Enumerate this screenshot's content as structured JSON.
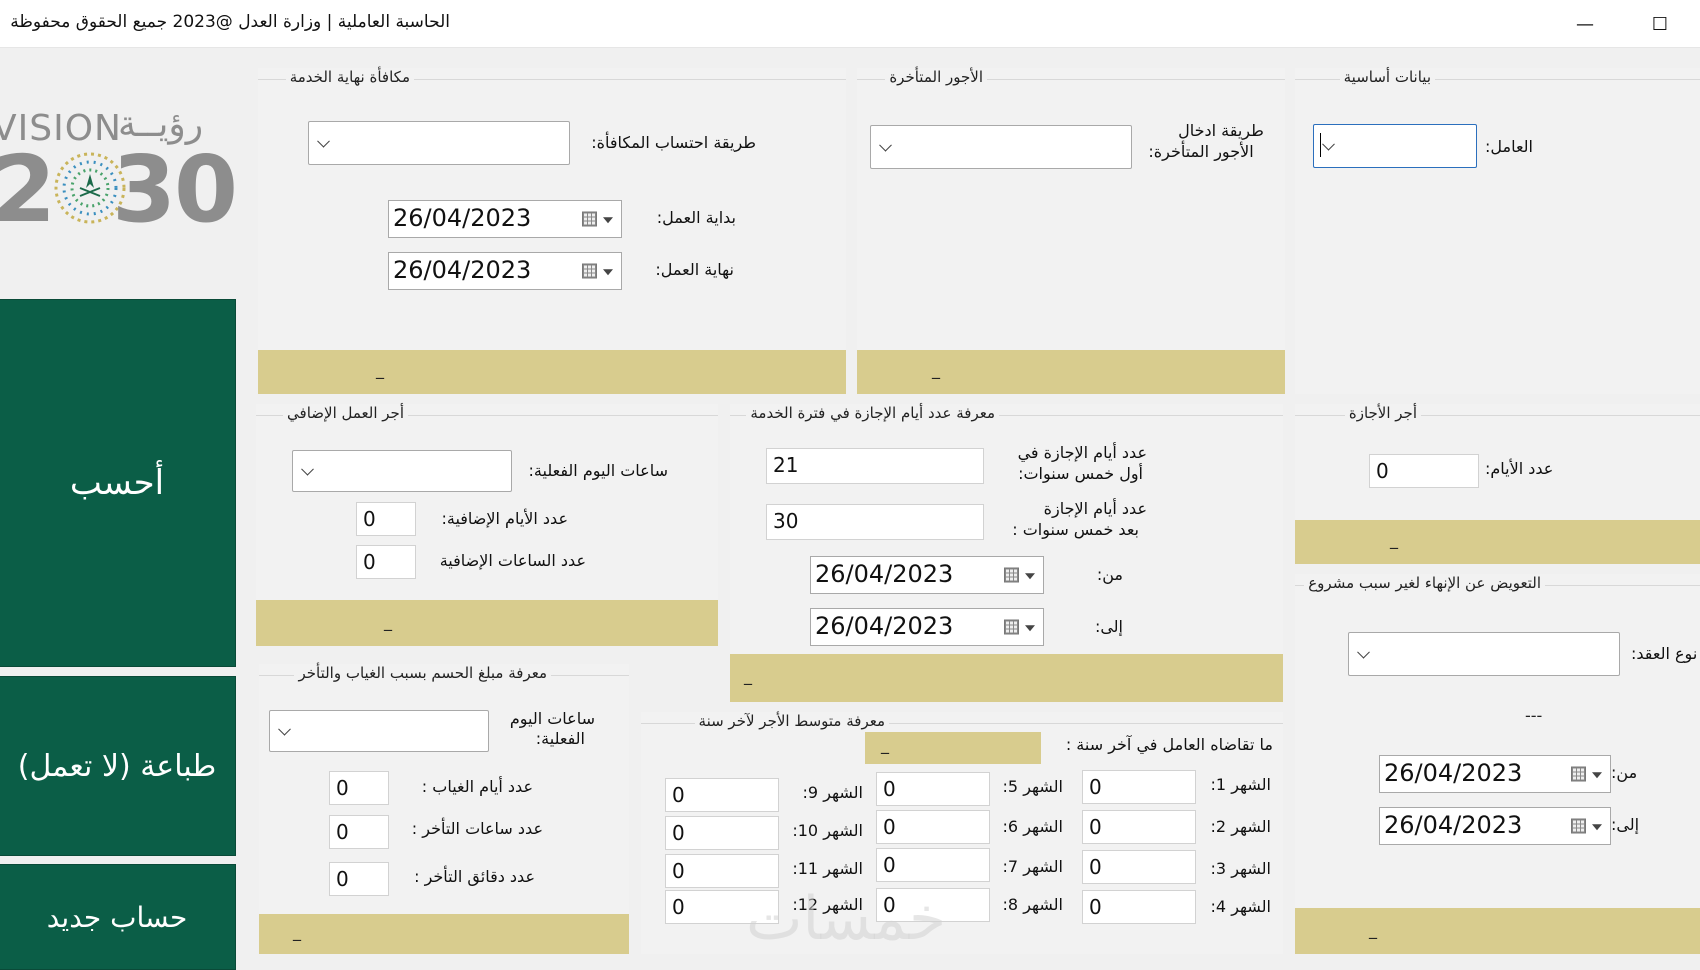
{
  "window": {
    "title": "الحاسبة العاملية | وزارة العدل @2023 جميع الحقوق محفوظة",
    "minimize_glyph": "—",
    "maximize_glyph": "☐"
  },
  "left": {
    "vision_word": "VISION",
    "vision_ar": "رؤيــة",
    "vision_year_start": "2",
    "vision_year_end": "30",
    "calc_button": "أحسب",
    "print_button": "طباعة (لا تعمل)",
    "new_button": "حساب جديد"
  },
  "basic": {
    "legend": "بيانات أساسية",
    "worker_label": "العامل:",
    "worker_value": ""
  },
  "late_wages": {
    "legend": "الأجور المتأخرة",
    "method_label_1": "طريقة ادخال",
    "method_label_2": "الأجور المتأخرة:",
    "method_value": "",
    "footer": "_"
  },
  "end_service": {
    "legend": "مكافأة نهاية الخدمة",
    "method_label": "طريقة احتساب المكافأة:",
    "method_value": "",
    "start_label": "بداية العمل:",
    "start_value": "26/04/2023",
    "end_label": "نهاية العمل:",
    "end_value": "26/04/2023",
    "footer": "_"
  },
  "leave_pay": {
    "legend": "أجر الأجازة",
    "days_label": "عدد الأيام:",
    "days_value": "0",
    "footer": "_"
  },
  "leave_days": {
    "legend": "معرفة عدد أيام الإجازة في فترة الخدمة",
    "first5_label_1": "عدد أيام الإجازة في",
    "first5_label_2": "أول خمس سنوات:",
    "first5_value": "21",
    "after5_label_1": "عدد أيام الإجازة",
    "after5_label_2": "بعد خمس سنوات :",
    "after5_value": "30",
    "from_label": "من:",
    "from_value": "26/04/2023",
    "to_label": "إلى:",
    "to_value": "26/04/2023",
    "footer": "_"
  },
  "overtime": {
    "legend": "أجر العمل الإضافي",
    "hours_label": "ساعات اليوم الفعلية:",
    "hours_value": "",
    "extra_days_label": "عدد الأيام الإضافية:",
    "extra_days_value": "0",
    "extra_hours_label": "عدد الساعات الإضافية",
    "extra_hours_value": "0",
    "footer": "_"
  },
  "termination": {
    "legend": "التعويض عن الإنهاء لغير سبب مشروع",
    "contract_label": "نوع العقد:",
    "contract_value": "",
    "sep": "---",
    "from_label": "من:",
    "from_value": "26/04/2023",
    "to_label": "إلى:",
    "to_value": "26/04/2023",
    "footer": "_"
  },
  "absence": {
    "legend": "معرفة مبلغ الحسم بسبب الغياب والتأخر",
    "hours_label_1": "ساعات اليوم",
    "hours_label_2": "الفعلية:",
    "hours_value": "",
    "absent_days_label": "عدد أيام الغياب :",
    "absent_days_value": "0",
    "late_hours_label": "عدد ساعات التأخر :",
    "late_hours_value": "0",
    "late_minutes_label": "عدد دقائق التأخر :",
    "late_minutes_value": "0",
    "footer": "_"
  },
  "avg_wage": {
    "legend": "معرفة متوسط الأجر لآخر سنة",
    "received_label": "ما تقاضاه العامل في آخر سنة :",
    "received_value": "_",
    "months": [
      {
        "label": "الشهر 1:",
        "value": "0"
      },
      {
        "label": "الشهر 2:",
        "value": "0"
      },
      {
        "label": "الشهر 3:",
        "value": "0"
      },
      {
        "label": "الشهر 4:",
        "value": "0"
      },
      {
        "label": "الشهر 5:",
        "value": "0"
      },
      {
        "label": "الشهر 6:",
        "value": "0"
      },
      {
        "label": "الشهر 7:",
        "value": "0"
      },
      {
        "label": "الشهر 8:",
        "value": "0"
      },
      {
        "label": "الشهر 9:",
        "value": "0"
      },
      {
        "label": "الشهر 10:",
        "value": "0"
      },
      {
        "label": "الشهر 11:",
        "value": "0"
      },
      {
        "label": "الشهر 12:",
        "value": "0"
      }
    ]
  },
  "watermark": "خمسات",
  "colors": {
    "green": "#0b5e47",
    "footer": "#d8cc8e",
    "panel": "#f2f2f2",
    "focus": "#2b6fbd"
  }
}
